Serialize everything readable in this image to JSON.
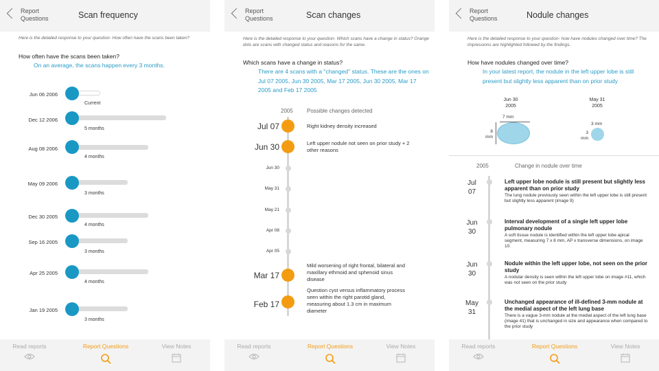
{
  "header": {
    "back_label": "Report Questions"
  },
  "footer": {
    "read": "Read reports",
    "questions": "Report Questions",
    "notes": "View Notes"
  },
  "screen1": {
    "title": "Scan frequency",
    "intro": "Here is the detailed response to your question- How often have the scans been taken?",
    "question": "How often have the scans been taken?",
    "answer": "On an average, the scans happen every 3 months.",
    "scans": [
      {
        "date": "Jun 06 2006",
        "label": "Current"
      },
      {
        "date": "Dec 12 2006",
        "label": "5 months"
      },
      {
        "date": "Aug 08 2006",
        "label": "4 months"
      },
      {
        "date": "May 09 2006",
        "label": "3 months"
      },
      {
        "date": "Dec 30 2005",
        "label": "4 months"
      },
      {
        "date": "Sep 16 2005",
        "label": "3 months"
      },
      {
        "date": "Apr 25 2005",
        "label": "4 months"
      },
      {
        "date": "Jan 19 2005",
        "label": "3 months"
      }
    ]
  },
  "screen2": {
    "title": "Scan changes",
    "intro": "Here is the detailed response to your question- Which scans have a change in status? Orange dots are scans with changed status and reasons for the same.",
    "question": "Which scans have a change in status?",
    "answer": "There are 4 scans with a \"changed\" status. These are the ones on Jul 07 2005, Jun 30 2005, Mar 17 2005, Jun 30 2005, Mar 17 2005 and Feb 17 2005",
    "year": "2005",
    "col_header": "Possible changes detected",
    "changes": [
      {
        "date": "Jul 07",
        "text": "Right kidney density increased"
      },
      {
        "date": "Jun 30",
        "text": "Left upper nodule not seen on prior study + 2 other reasons"
      },
      {
        "date": "Mar 17",
        "text": "Mild worsening of right frontal, bilateral and maxillary ethmoid and sphenoid sinus disease"
      },
      {
        "date": "Feb 17",
        "text": "Question cyst versus inflammatory process seen within the right parotid gland, measuring about 1.3 cm in maximum diameter"
      }
    ],
    "minor_dates": [
      "Jun 30",
      "May 31",
      "May 21",
      "Apr 08",
      "Apr 05"
    ]
  },
  "screen3": {
    "title": "Nodule changes",
    "intro": "Here is the detailed response to your question- how have nodules changed over time? The impressions are highlighted followed by the findings.",
    "question": "How have nodules changed over time?",
    "answer": "In your latest report, the nodule in the left upper lobe is still present but slightly less apparent than on prior study",
    "compare": [
      {
        "date": "Jun 30",
        "year": "2005",
        "w": "7 mm",
        "h": "8 mm"
      },
      {
        "date": "May 31",
        "year": "2005",
        "w": "3 mm",
        "h": "3 mm"
      }
    ],
    "year": "2005",
    "col_header": "Change in nodule over time",
    "entries": [
      {
        "month": "Jul",
        "day": "07",
        "title": "Left upper lobe nodule is still present but slightly less apparent than on prior study",
        "body": "The lung nodule previously seen within the left upper lobe is still present but slightly less apparent (image 9)"
      },
      {
        "month": "Jun",
        "day": "30",
        "title": "Interval development of a single left upper lobe pulmonary nodule",
        "body": "A soft tissue nodule is identified within the left upper lobe apical segment, measuring 7 x 8 mm, AP x transverse dimensions, on image 10."
      },
      {
        "month": "Jun",
        "day": "30",
        "title": "Nodule within the left upper lobe, not seen on the prior study",
        "body": "A nodular density is seen within the left upper lobe on image #11, which was not seen on the prior study"
      },
      {
        "month": "May",
        "day": "31",
        "title": "Unchanged appearance of ill-defined 3-mm nodule at the medial aspect of the left lung base",
        "body": "There is a vague 3-mm nodule at the medial aspect of the left lung base (image 41) that is unchanged in size and appearance when compared to the prior study"
      }
    ]
  }
}
